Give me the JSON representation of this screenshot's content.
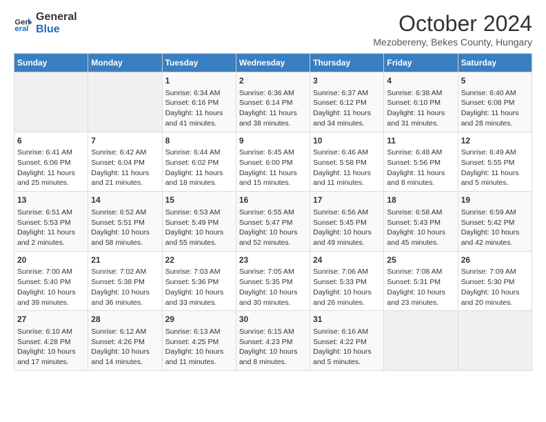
{
  "header": {
    "logo_line1": "General",
    "logo_line2": "Blue",
    "month_title": "October 2024",
    "subtitle": "Mezobereny, Bekes County, Hungary"
  },
  "days_of_week": [
    "Sunday",
    "Monday",
    "Tuesday",
    "Wednesday",
    "Thursday",
    "Friday",
    "Saturday"
  ],
  "weeks": [
    [
      {
        "day": "",
        "info": ""
      },
      {
        "day": "",
        "info": ""
      },
      {
        "day": "1",
        "info": "Sunrise: 6:34 AM\nSunset: 6:16 PM\nDaylight: 11 hours and 41 minutes."
      },
      {
        "day": "2",
        "info": "Sunrise: 6:36 AM\nSunset: 6:14 PM\nDaylight: 11 hours and 38 minutes."
      },
      {
        "day": "3",
        "info": "Sunrise: 6:37 AM\nSunset: 6:12 PM\nDaylight: 11 hours and 34 minutes."
      },
      {
        "day": "4",
        "info": "Sunrise: 6:38 AM\nSunset: 6:10 PM\nDaylight: 11 hours and 31 minutes."
      },
      {
        "day": "5",
        "info": "Sunrise: 6:40 AM\nSunset: 6:08 PM\nDaylight: 11 hours and 28 minutes."
      }
    ],
    [
      {
        "day": "6",
        "info": "Sunrise: 6:41 AM\nSunset: 6:06 PM\nDaylight: 11 hours and 25 minutes."
      },
      {
        "day": "7",
        "info": "Sunrise: 6:42 AM\nSunset: 6:04 PM\nDaylight: 11 hours and 21 minutes."
      },
      {
        "day": "8",
        "info": "Sunrise: 6:44 AM\nSunset: 6:02 PM\nDaylight: 11 hours and 18 minutes."
      },
      {
        "day": "9",
        "info": "Sunrise: 6:45 AM\nSunset: 6:00 PM\nDaylight: 11 hours and 15 minutes."
      },
      {
        "day": "10",
        "info": "Sunrise: 6:46 AM\nSunset: 5:58 PM\nDaylight: 11 hours and 11 minutes."
      },
      {
        "day": "11",
        "info": "Sunrise: 6:48 AM\nSunset: 5:56 PM\nDaylight: 11 hours and 8 minutes."
      },
      {
        "day": "12",
        "info": "Sunrise: 6:49 AM\nSunset: 5:55 PM\nDaylight: 11 hours and 5 minutes."
      }
    ],
    [
      {
        "day": "13",
        "info": "Sunrise: 6:51 AM\nSunset: 5:53 PM\nDaylight: 11 hours and 2 minutes."
      },
      {
        "day": "14",
        "info": "Sunrise: 6:52 AM\nSunset: 5:51 PM\nDaylight: 10 hours and 58 minutes."
      },
      {
        "day": "15",
        "info": "Sunrise: 6:53 AM\nSunset: 5:49 PM\nDaylight: 10 hours and 55 minutes."
      },
      {
        "day": "16",
        "info": "Sunrise: 6:55 AM\nSunset: 5:47 PM\nDaylight: 10 hours and 52 minutes."
      },
      {
        "day": "17",
        "info": "Sunrise: 6:56 AM\nSunset: 5:45 PM\nDaylight: 10 hours and 49 minutes."
      },
      {
        "day": "18",
        "info": "Sunrise: 6:58 AM\nSunset: 5:43 PM\nDaylight: 10 hours and 45 minutes."
      },
      {
        "day": "19",
        "info": "Sunrise: 6:59 AM\nSunset: 5:42 PM\nDaylight: 10 hours and 42 minutes."
      }
    ],
    [
      {
        "day": "20",
        "info": "Sunrise: 7:00 AM\nSunset: 5:40 PM\nDaylight: 10 hours and 39 minutes."
      },
      {
        "day": "21",
        "info": "Sunrise: 7:02 AM\nSunset: 5:38 PM\nDaylight: 10 hours and 36 minutes."
      },
      {
        "day": "22",
        "info": "Sunrise: 7:03 AM\nSunset: 5:36 PM\nDaylight: 10 hours and 33 minutes."
      },
      {
        "day": "23",
        "info": "Sunrise: 7:05 AM\nSunset: 5:35 PM\nDaylight: 10 hours and 30 minutes."
      },
      {
        "day": "24",
        "info": "Sunrise: 7:06 AM\nSunset: 5:33 PM\nDaylight: 10 hours and 26 minutes."
      },
      {
        "day": "25",
        "info": "Sunrise: 7:08 AM\nSunset: 5:31 PM\nDaylight: 10 hours and 23 minutes."
      },
      {
        "day": "26",
        "info": "Sunrise: 7:09 AM\nSunset: 5:30 PM\nDaylight: 10 hours and 20 minutes."
      }
    ],
    [
      {
        "day": "27",
        "info": "Sunrise: 6:10 AM\nSunset: 4:28 PM\nDaylight: 10 hours and 17 minutes."
      },
      {
        "day": "28",
        "info": "Sunrise: 6:12 AM\nSunset: 4:26 PM\nDaylight: 10 hours and 14 minutes."
      },
      {
        "day": "29",
        "info": "Sunrise: 6:13 AM\nSunset: 4:25 PM\nDaylight: 10 hours and 11 minutes."
      },
      {
        "day": "30",
        "info": "Sunrise: 6:15 AM\nSunset: 4:23 PM\nDaylight: 10 hours and 8 minutes."
      },
      {
        "day": "31",
        "info": "Sunrise: 6:16 AM\nSunset: 4:22 PM\nDaylight: 10 hours and 5 minutes."
      },
      {
        "day": "",
        "info": ""
      },
      {
        "day": "",
        "info": ""
      }
    ]
  ]
}
